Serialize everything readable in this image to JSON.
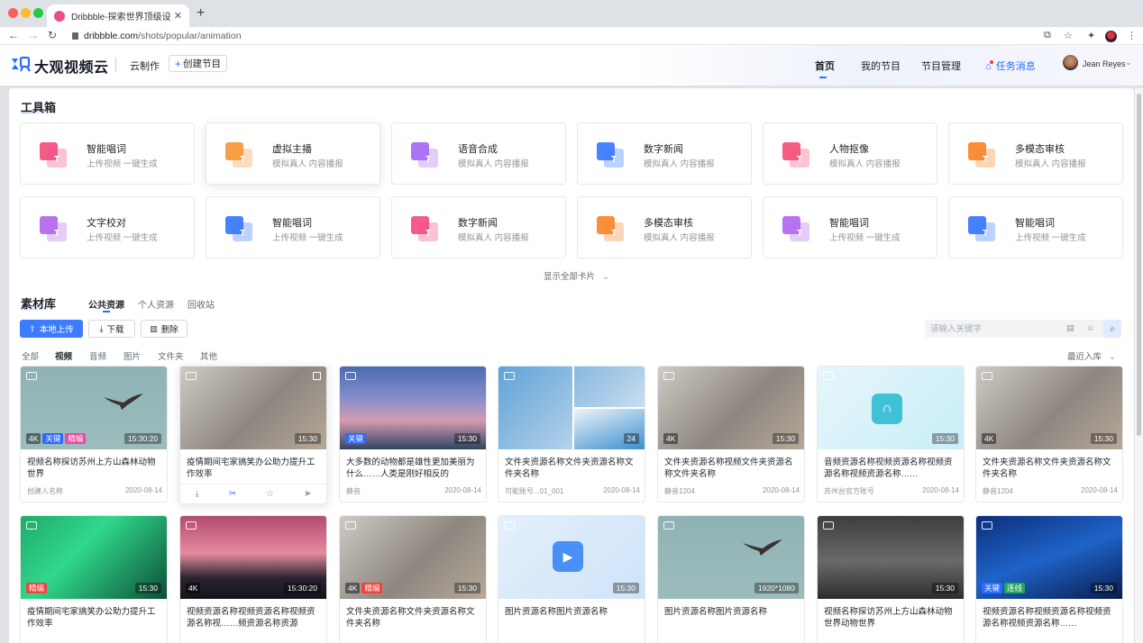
{
  "browser": {
    "tab_title": "Dribbble-探索世界顶级设计师和",
    "tab_close": "✕",
    "new_tab": "+",
    "url_host": "dribbble.com",
    "url_path": "/shots/popular/animation"
  },
  "header": {
    "brand": "大观视频云",
    "cloud_make": "云制作",
    "create_label": "创建节目",
    "nav": [
      "首页",
      "我的节目",
      "节目管理"
    ],
    "task_message": "任务消息",
    "user_name": "Jean Reyes"
  },
  "toolbox": {
    "title": "工具箱",
    "show_all": "显示全部卡片",
    "tools": [
      {
        "name": "智能唱词",
        "desc": "上传视频 一键生成",
        "icon": "lyrics-icon",
        "color": "#f25283"
      },
      {
        "name": "虚拟主播",
        "desc": "模拟真人 内容播报",
        "icon": "virtual-host-icon",
        "color": "#f79a3e"
      },
      {
        "name": "语音合成",
        "desc": "模拟真人 内容播报",
        "icon": "speech-synthesis-icon",
        "color": "#a86cf5"
      },
      {
        "name": "数字新闻",
        "desc": "模拟真人 内容播报",
        "icon": "digital-news-icon",
        "color": "#3d7bff"
      },
      {
        "name": "人物抠像",
        "desc": "模拟真人 内容播报",
        "icon": "portrait-matting-icon",
        "color": "#f2557a"
      },
      {
        "name": "多模态审核",
        "desc": "模拟真人 内容播报",
        "icon": "multimodal-review-icon",
        "color": "#f78a2e"
      },
      {
        "name": "文字校对",
        "desc": "上传视频 一键生成",
        "icon": "proofread-icon",
        "color": "#b56cf0"
      },
      {
        "name": "智能唱词",
        "desc": "上传视频 一键生成",
        "icon": "lyrics-icon",
        "color": "#3d7bff"
      },
      {
        "name": "数字新闻",
        "desc": "模拟真人 内容播报",
        "icon": "digital-news-icon",
        "color": "#f25283"
      },
      {
        "name": "多模态审核",
        "desc": "模拟真人 内容播报",
        "icon": "multimodal-review-icon",
        "color": "#f78a2e"
      },
      {
        "name": "智能唱词",
        "desc": "上传视频 一键生成",
        "icon": "lyrics-icon",
        "color": "#b56cf0"
      },
      {
        "name": "智能唱词",
        "desc": "上传视频 一键生成",
        "icon": "lyrics-icon",
        "color": "#3d7bff"
      }
    ]
  },
  "library": {
    "title": "素材库",
    "subtabs": [
      "公共资源",
      "个人资源",
      "回收站"
    ],
    "buttons": {
      "upload": "本地上传",
      "download": "下载",
      "delete": "删除"
    },
    "search_placeholder": "请输入关键字",
    "filters": [
      "全部",
      "视频",
      "音频",
      "图片",
      "文件夹",
      "其他"
    ],
    "sort_label": "最近入库",
    "assets": [
      {
        "title": "视频名称探访苏州上方山森林动物世界",
        "author": "创建人名称",
        "date": "2020-08-14",
        "badges": [
          {
            "t": "4K",
            "c": "b-4k"
          },
          {
            "t": "关键",
            "c": "b-blue"
          },
          {
            "t": "精编",
            "c": "b-pink"
          }
        ],
        "duration": "15:30:20"
      },
      {
        "title": "疫情期间宅家搞笑办公助力提升工作效率",
        "author": "",
        "date": "",
        "badges": [],
        "duration": "15:30"
      },
      {
        "title": "大多数的动物都是雄性更加美丽为什么……人类是刚好相反的",
        "author": "静音",
        "date": "2020-08-14",
        "badges": [
          {
            "t": "关键",
            "c": "b-blue"
          }
        ],
        "duration": "15:30"
      },
      {
        "title": "文件夹资源名称文件夹资源名称文件夹名称",
        "author": "可能账号...01_001",
        "date": "2020-08-14",
        "badges": [],
        "duration": "24"
      },
      {
        "title": "文件夹资源名称视频文件夹资源名称文件夹名称",
        "author": "静音1204",
        "date": "2020-08-14",
        "badges": [
          {
            "t": "4K",
            "c": "b-4k"
          }
        ],
        "duration": "15:30"
      },
      {
        "title": "音频资源名称视频资源名称视频资源名称视频资源名称……",
        "author": "苏州台官方账号",
        "date": "2020-08-14",
        "badges": [],
        "duration": "15:30"
      },
      {
        "title": "文件夹资源名称文件夹资源名称文件夹名称",
        "author": "静音1204",
        "date": "2020-08-14",
        "badges": [
          {
            "t": "4K",
            "c": "b-4k"
          }
        ],
        "duration": "15:30"
      },
      {
        "title": "疫情期间宅家搞笑办公助力提升工作效率",
        "author": "",
        "date": "",
        "badges": [
          {
            "t": "精编",
            "c": "b-red"
          }
        ],
        "duration": "15:30"
      },
      {
        "title": "视频资源名称视频资源名称视频资源名称视……频资源名称资源",
        "author": "",
        "date": "",
        "badges": [
          {
            "t": "4K",
            "c": "b-4k"
          }
        ],
        "duration": "15:30:20"
      },
      {
        "title": "文件夹资源名称文件夹资源名称文件夹名称",
        "author": "",
        "date": "",
        "badges": [
          {
            "t": "4K",
            "c": "b-4k"
          },
          {
            "t": "精编",
            "c": "b-red"
          }
        ],
        "duration": "15:30"
      },
      {
        "title": "图片资源名称图片资源名称",
        "author": "",
        "date": "",
        "badges": [],
        "duration": "15:30"
      },
      {
        "title": "图片资源名称图片资源名称",
        "author": "",
        "date": "",
        "badges": [],
        "duration": "1920*1080"
      },
      {
        "title": "视频名称探访苏州上方山森林动物世界动物世界",
        "author": "",
        "date": "",
        "badges": [],
        "duration": "15:30"
      },
      {
        "title": "视频资源名称视频资源名称视频资源名称视频资源名称……",
        "author": "",
        "date": "",
        "badges": [
          {
            "t": "关键",
            "c": "b-blue"
          },
          {
            "t": "连线",
            "c": "b-green"
          }
        ],
        "duration": "15:30"
      }
    ]
  }
}
